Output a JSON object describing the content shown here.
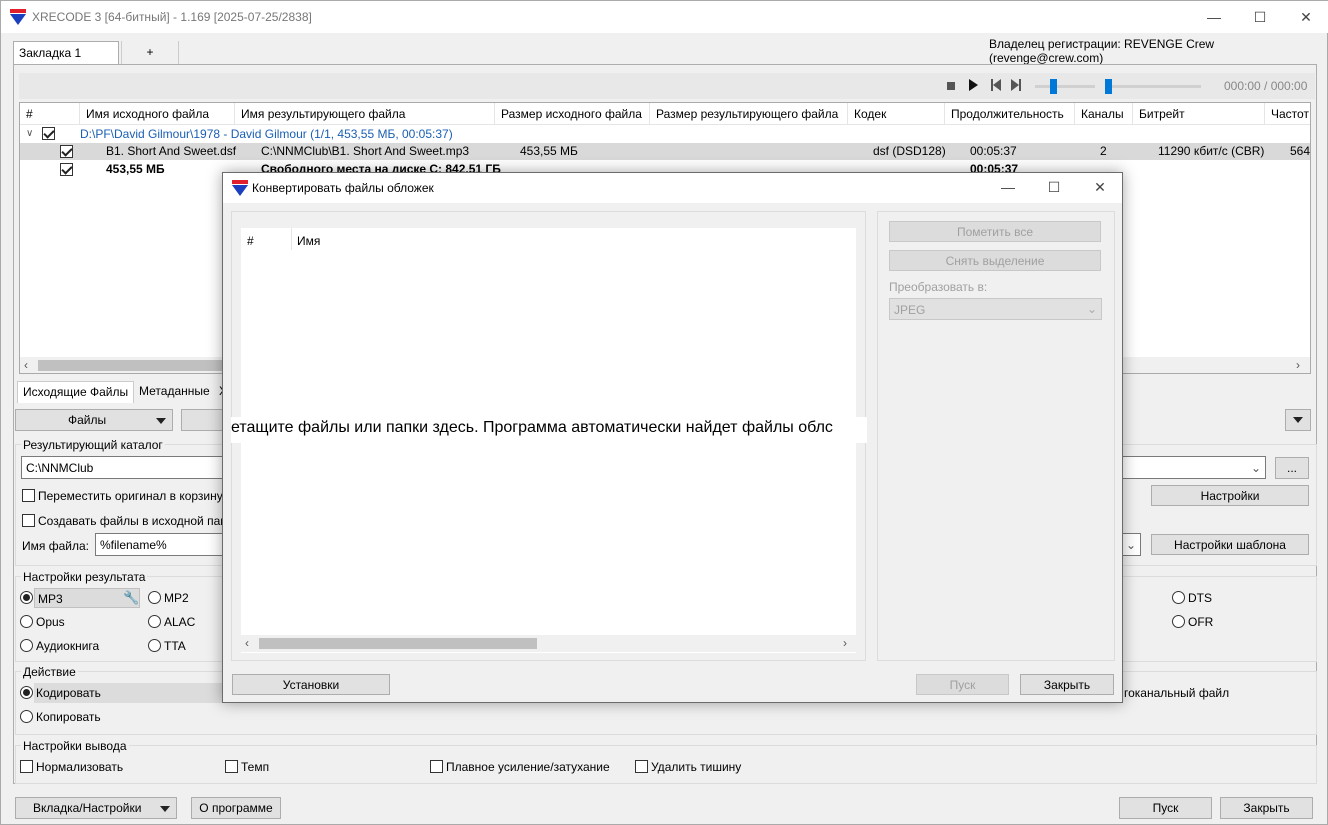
{
  "window": {
    "title": "XRECODE 3 [64-битный] - 1.169 [2025-07-25/2838]"
  },
  "tabs": [
    {
      "label": "Закладка 1"
    },
    {
      "label": "+"
    }
  ],
  "owner": "Владелец регистрации: REVENGE Crew (revenge@crew.com)",
  "player": {
    "time": "000:00 / 000:00",
    "volume_pct": 28,
    "position_pct": 0
  },
  "table": {
    "headers": [
      "#",
      "Имя исходного файла",
      "Имя результирующего файла",
      "Размер исходного файла",
      "Размер результирующего файла",
      "Кодек",
      "Продолжительность",
      "Каналы",
      "Битрейт",
      "Частот"
    ],
    "group": "D:\\PF\\David Gilmour\\1978 - David Gilmour (1/1, 453,55 МБ, 00:05:37)",
    "row": {
      "src": "B1. Short And Sweet.dsf",
      "dst": "C:\\NNMClub\\B1. Short And Sweet.mp3",
      "size": "453,55 МБ",
      "codec": "dsf (DSD128)",
      "duration": "00:05:37",
      "channels": "2",
      "bitrate": "11290 кбит/с (CBR)",
      "freq": "564"
    },
    "total": {
      "size": "453,55 МБ",
      "free": "Свободного места на диске C: 842,51 ГБ",
      "duration": "00:05:37"
    }
  },
  "lower_tabs": [
    "Исходящие Файлы",
    "Метаданные",
    "Х"
  ],
  "files_button": "Файлы",
  "output": {
    "title": "Результирующий каталог",
    "dir": "C:\\NNMClub",
    "move_original": "Переместить оригинал в корзину",
    "create_in_source": "Создавать файлы в исходной папке",
    "settings_btn": "Настройки",
    "filename_label": "Имя файла:",
    "filename_value": "%filename%",
    "template_btn": "Настройки шаблона",
    "browse": "..."
  },
  "result_settings": {
    "title": "Настройки результата",
    "formats": [
      "MP3",
      "MP2",
      "Opus",
      "ALAC",
      "Аудиокнига",
      "TTA",
      "DTS",
      "OFR"
    ],
    "selected": "MP3"
  },
  "action": {
    "title": "Действие",
    "encode": "Кодировать",
    "copy": "Копировать",
    "single_file": "гоканальный файл"
  },
  "output_settings": {
    "title": "Настройки вывода",
    "normalize": "Нормализовать",
    "tempo": "Темп",
    "fade": "Плавное усиление/затухание",
    "silence": "Удалить тишину"
  },
  "bottom": {
    "tab_settings": "Вкладка/Настройки",
    "about": "О программе",
    "start": "Пуск",
    "close": "Закрыть"
  },
  "dialog": {
    "title": "Конвертировать файлы обложек",
    "col_num": "#",
    "col_name": "Имя",
    "drop_hint": "етащите файлы или папки здесь. Программа автоматически найдет файлы облс",
    "mark_all": "Пометить все",
    "unmark": "Снять выделение",
    "convert_label": "Преобразовать в:",
    "convert_value": "JPEG",
    "setup": "Установки",
    "start": "Пуск",
    "close": "Закрыть"
  },
  "colors": {
    "accent": "#0078d7",
    "group_link": "#1a5fb4"
  }
}
